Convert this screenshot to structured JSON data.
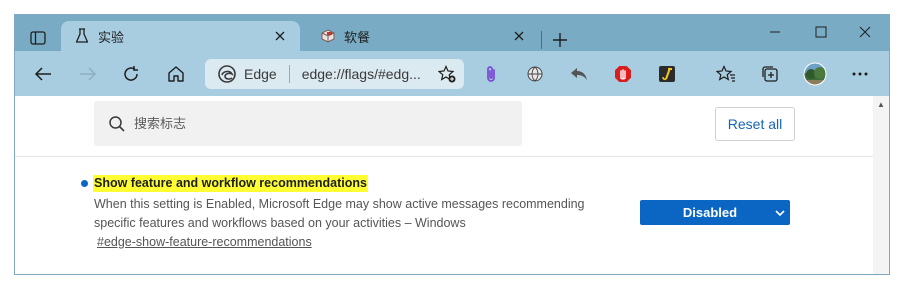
{
  "tabs": [
    {
      "title": "实验",
      "icon": "flask-icon",
      "active": true
    },
    {
      "title": "软餐",
      "icon": "box-icon",
      "active": false
    }
  ],
  "address_bar": {
    "site_label": "Edge",
    "url": "edge://flags/#edg..."
  },
  "toolbar_icons": [
    "back-icon",
    "forward-icon",
    "refresh-icon",
    "home-icon",
    "paperclip-extension-icon",
    "globe-extension-icon",
    "reply-extension-icon",
    "stop-hand-extension-icon",
    "script-extension-icon",
    "favorites-icon",
    "collections-icon",
    "profile-avatar",
    "more-icon"
  ],
  "search": {
    "placeholder": "搜索标志"
  },
  "reset_all_label": "Reset all",
  "flag": {
    "title": "Show feature and workflow recommendations",
    "description": "When this setting is Enabled, Microsoft Edge may show active messages recommending specific features and workflows based on your activities – Windows",
    "link": "#edge-show-feature-recommendations",
    "selected_option": "Disabled"
  },
  "colors": {
    "titlebar": "#79acc4",
    "toolbar": "#a8cde0",
    "accent": "#0b66c3",
    "highlight": "#ffff33"
  }
}
